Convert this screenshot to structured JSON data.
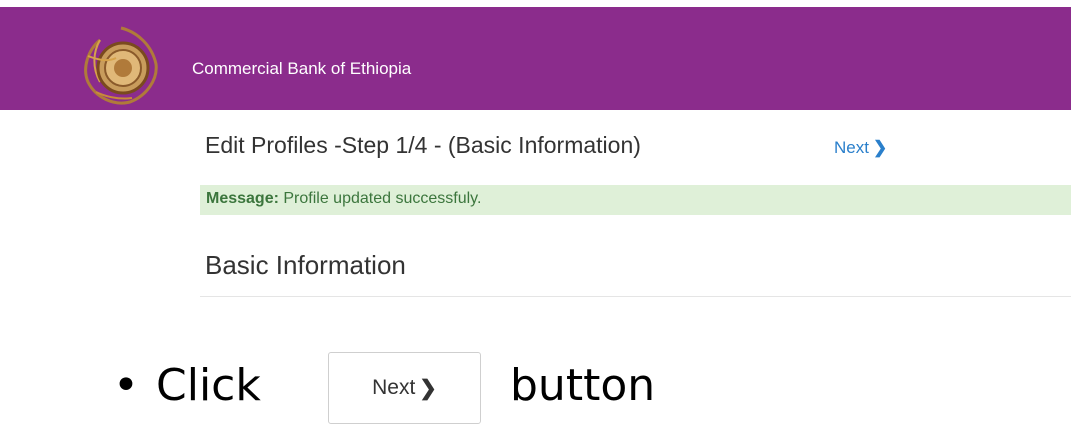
{
  "header": {
    "brand_name": "Commercial Bank of Ethiopia",
    "background_color": "#8B2C8C",
    "logo_icon": "bank-seal-logo"
  },
  "form": {
    "title": "Edit Profiles -Step 1/4 - (Basic Information)",
    "next_link_label": "Next",
    "next_link_icon": "chevron-right-icon"
  },
  "message": {
    "label": "Message:",
    "text": "Profile updated successfuly."
  },
  "section": {
    "title": "Basic Information"
  },
  "instruction": {
    "bullet": "•",
    "click_text": "Click",
    "button_label": "Next",
    "button_text": "button"
  }
}
